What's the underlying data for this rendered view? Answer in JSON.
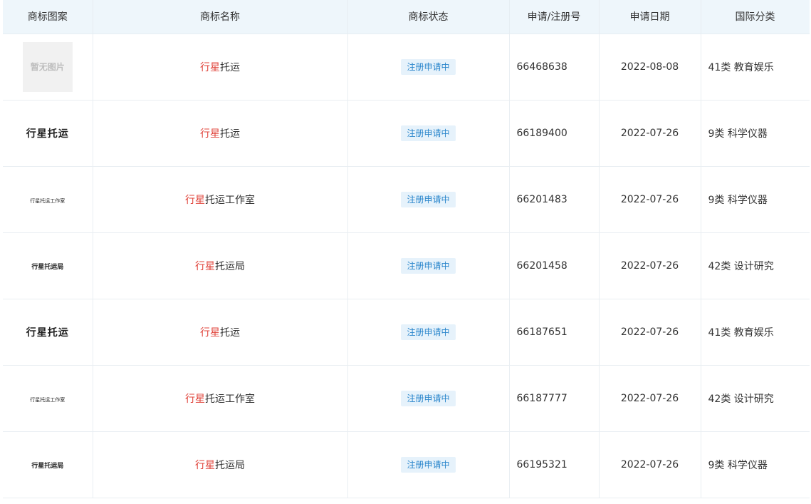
{
  "headers": {
    "image": "商标图案",
    "name": "商标名称",
    "status": "商标状态",
    "reg_no": "申请/注册号",
    "date": "申请日期",
    "class": "国际分类"
  },
  "colors": {
    "highlight": "#e0443b",
    "status_text": "#2a86cc",
    "status_bg": "#e6f2fb",
    "header_bg": "#eef6fb"
  },
  "rows": [
    {
      "image": "暂无图片",
      "name_hl": "行星",
      "name_rest": "托运",
      "status": "注册申请中",
      "reg_no": "66468638",
      "date": "2022-08-08",
      "class": "41类 教育娱乐"
    },
    {
      "image": "行星托运",
      "name_hl": "行星",
      "name_rest": "托运",
      "status": "注册申请中",
      "reg_no": "66189400",
      "date": "2022-07-26",
      "class": "9类 科学仪器"
    },
    {
      "image": "行星托运工作室",
      "name_hl": "行星",
      "name_rest": "托运工作室",
      "status": "注册申请中",
      "reg_no": "66201483",
      "date": "2022-07-26",
      "class": "9类 科学仪器"
    },
    {
      "image": "行星托运局",
      "name_hl": "行星",
      "name_rest": "托运局",
      "status": "注册申请中",
      "reg_no": "66201458",
      "date": "2022-07-26",
      "class": "42类 设计研究"
    },
    {
      "image": "行星托运",
      "name_hl": "行星",
      "name_rest": "托运",
      "status": "注册申请中",
      "reg_no": "66187651",
      "date": "2022-07-26",
      "class": "41类 教育娱乐"
    },
    {
      "image": "行星托运工作室",
      "name_hl": "行星",
      "name_rest": "托运工作室",
      "status": "注册申请中",
      "reg_no": "66187777",
      "date": "2022-07-26",
      "class": "42类 设计研究"
    },
    {
      "image": "行星托运局",
      "name_hl": "行星",
      "name_rest": "托运局",
      "status": "注册申请中",
      "reg_no": "66195321",
      "date": "2022-07-26",
      "class": "9类 科学仪器"
    }
  ]
}
